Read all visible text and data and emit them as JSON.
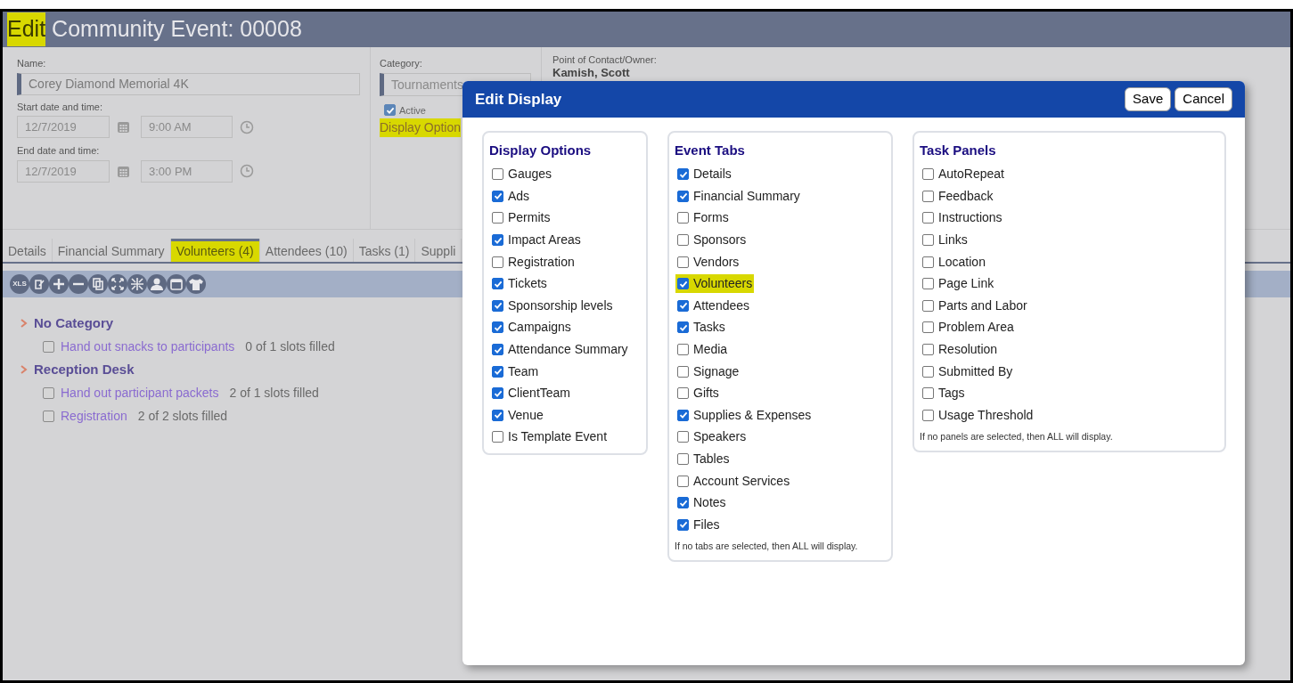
{
  "header": {
    "title_parts": [
      {
        "text": "Edit",
        "highlighted": true
      },
      {
        "text": "Community Event: 00008",
        "highlighted": false
      }
    ]
  },
  "form": {
    "name_label": "Name:",
    "name_value": "Corey Diamond Memorial 4K",
    "start_label": "Start date and time:",
    "start_date": "12/7/2019",
    "start_time": "9:00 AM",
    "end_label": "End date and time:",
    "end_date": "12/7/2019",
    "end_time": "3:00 PM",
    "category_label": "Category:",
    "category_value": "Tournaments",
    "active": {
      "label": "Active",
      "checked": true
    },
    "display_options_link": {
      "text": "Display Option",
      "highlighted": true
    },
    "contact_label": "Point of Contact/Owner:",
    "contact_value": "Kamish, Scott"
  },
  "tabs": [
    {
      "label": "Details",
      "selected": false,
      "highlighted": false
    },
    {
      "label": "Financial Summary",
      "selected": false,
      "highlighted": false
    },
    {
      "label": "Volunteers (4)",
      "selected": true,
      "highlighted": true
    },
    {
      "label": "Attendees (10)",
      "selected": false,
      "highlighted": false
    },
    {
      "label": "Tasks (1)",
      "selected": false,
      "highlighted": false
    },
    {
      "label": "Suppli",
      "selected": false,
      "highlighted": false
    }
  ],
  "toolbar": [
    {
      "kind": "xls",
      "text": "XLS"
    },
    {
      "kind": "edit"
    },
    {
      "kind": "plus"
    },
    {
      "kind": "minus"
    },
    {
      "kind": "copy"
    },
    {
      "kind": "expand"
    },
    {
      "kind": "collapse"
    },
    {
      "kind": "person"
    },
    {
      "kind": "calendar"
    },
    {
      "kind": "shirt"
    }
  ],
  "categories": [
    {
      "name": "No Category",
      "items": [
        {
          "label": "Hand out snacks to participants",
          "slots": "0 of 1 slots filled",
          "checked": false
        }
      ]
    },
    {
      "name": "Reception Desk",
      "items": [
        {
          "label": "Hand out participant packets",
          "slots": "2 of 1 slots filled",
          "checked": false
        },
        {
          "label": "Registration",
          "slots": "2 of 2 slots filled",
          "checked": false
        }
      ]
    }
  ],
  "dialog": {
    "title": "Edit Display",
    "buttons": [
      "Save",
      "Cancel"
    ],
    "panels": [
      {
        "title": "Display Options",
        "options": [
          {
            "label": "Gauges",
            "checked": false,
            "highlighted": false
          },
          {
            "label": "Ads",
            "checked": true,
            "highlighted": false
          },
          {
            "label": "Permits",
            "checked": false,
            "highlighted": false
          },
          {
            "label": "Impact Areas",
            "checked": true,
            "highlighted": false
          },
          {
            "label": "Registration",
            "checked": false,
            "highlighted": false
          },
          {
            "label": "Tickets",
            "checked": true,
            "highlighted": false
          },
          {
            "label": "Sponsorship levels",
            "checked": true,
            "highlighted": false
          },
          {
            "label": "Campaigns",
            "checked": true,
            "highlighted": false
          },
          {
            "label": "Attendance Summary",
            "checked": true,
            "highlighted": false
          },
          {
            "label": "Team",
            "checked": true,
            "highlighted": false
          },
          {
            "label": "ClientTeam",
            "checked": true,
            "highlighted": false
          },
          {
            "label": "Venue",
            "checked": true,
            "highlighted": false
          },
          {
            "label": "Is Template Event",
            "checked": false,
            "highlighted": false
          }
        ]
      },
      {
        "title": "Event Tabs",
        "options": [
          {
            "label": "Details",
            "checked": true,
            "highlighted": false
          },
          {
            "label": "Financial Summary",
            "checked": true,
            "highlighted": false
          },
          {
            "label": "Forms",
            "checked": false,
            "highlighted": false
          },
          {
            "label": "Sponsors",
            "checked": false,
            "highlighted": false
          },
          {
            "label": "Vendors",
            "checked": false,
            "highlighted": false
          },
          {
            "label": "Volunteers",
            "checked": true,
            "highlighted": true
          },
          {
            "label": "Attendees",
            "checked": true,
            "highlighted": false
          },
          {
            "label": "Tasks",
            "checked": true,
            "highlighted": false
          },
          {
            "label": "Media",
            "checked": false,
            "highlighted": false
          },
          {
            "label": "Signage",
            "checked": false,
            "highlighted": false
          },
          {
            "label": "Gifts",
            "checked": false,
            "highlighted": false
          },
          {
            "label": "Supplies & Expenses",
            "checked": true,
            "highlighted": false
          },
          {
            "label": "Speakers",
            "checked": false,
            "highlighted": false
          },
          {
            "label": "Tables",
            "checked": false,
            "highlighted": false
          },
          {
            "label": "Account Services",
            "checked": false,
            "highlighted": false
          },
          {
            "label": "Notes",
            "checked": true,
            "highlighted": false
          },
          {
            "label": "Files",
            "checked": true,
            "highlighted": false
          }
        ],
        "note": "If no tabs are selected, then ALL will display."
      },
      {
        "title": "Task Panels",
        "options": [
          {
            "label": "AutoRepeat",
            "checked": false,
            "highlighted": false
          },
          {
            "label": "Feedback",
            "checked": false,
            "highlighted": false
          },
          {
            "label": "Instructions",
            "checked": false,
            "highlighted": false
          },
          {
            "label": "Links",
            "checked": false,
            "highlighted": false
          },
          {
            "label": "Location",
            "checked": false,
            "highlighted": false
          },
          {
            "label": "Page Link",
            "checked": false,
            "highlighted": false
          },
          {
            "label": "Parts and Labor",
            "checked": false,
            "highlighted": false
          },
          {
            "label": "Problem Area",
            "checked": false,
            "highlighted": false
          },
          {
            "label": "Resolution",
            "checked": false,
            "highlighted": false
          },
          {
            "label": "Submitted By",
            "checked": false,
            "highlighted": false
          },
          {
            "label": "Tags",
            "checked": false,
            "highlighted": false
          },
          {
            "label": "Usage Threshold",
            "checked": false,
            "highlighted": false
          }
        ],
        "note": "If no panels are selected, then ALL will display."
      }
    ]
  }
}
